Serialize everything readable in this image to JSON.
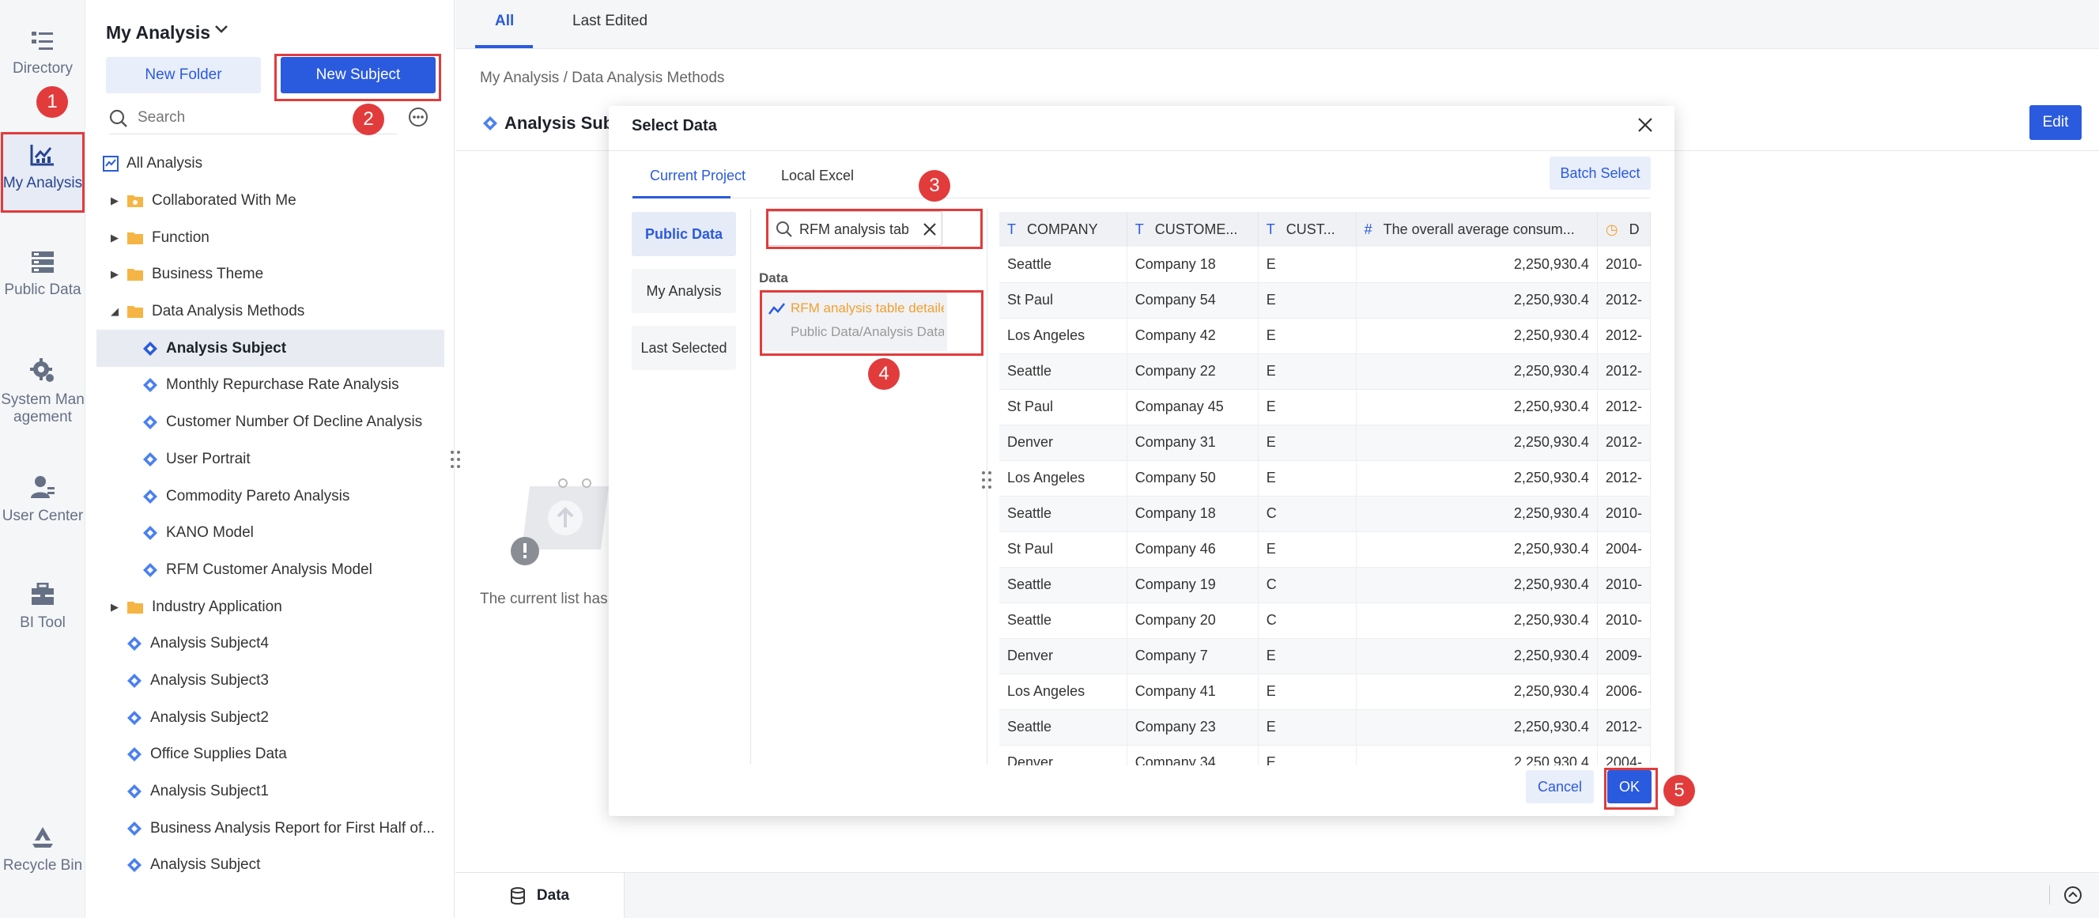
{
  "rail": {
    "items": [
      {
        "label": "Directory"
      },
      {
        "label": "My Analysis"
      },
      {
        "label": "Public Data"
      },
      {
        "label": "System Man agement"
      },
      {
        "label": "User Center"
      },
      {
        "label": "BI Tool"
      },
      {
        "label": "Recycle Bin"
      }
    ]
  },
  "directory": {
    "title": "My Analysis",
    "new_folder": "New Folder",
    "new_subject": "New Subject",
    "search_placeholder": "Search",
    "tree": [
      {
        "label": "All Analysis"
      },
      {
        "label": "Collaborated With Me"
      },
      {
        "label": "Function"
      },
      {
        "label": "Business Theme"
      },
      {
        "label": "Data Analysis Methods"
      },
      {
        "label": "Analysis Subject"
      },
      {
        "label": "Monthly Repurchase Rate Analysis"
      },
      {
        "label": "Customer Number Of Decline Analysis"
      },
      {
        "label": "User Portrait"
      },
      {
        "label": "Commodity Pareto Analysis"
      },
      {
        "label": "KANO Model"
      },
      {
        "label": "RFM Customer Analysis Model"
      },
      {
        "label": "Industry Application"
      },
      {
        "label": "Analysis Subject4"
      },
      {
        "label": "Analysis Subject3"
      },
      {
        "label": "Analysis Subject2"
      },
      {
        "label": "Office Supplies Data"
      },
      {
        "label": "Analysis Subject1"
      },
      {
        "label": "Business Analysis Report for First Half of..."
      },
      {
        "label": "Analysis Subject"
      }
    ]
  },
  "main": {
    "tabs": [
      {
        "label": "All"
      },
      {
        "label": "Last Edited"
      }
    ],
    "breadcrumb": "My Analysis  /  Data Analysis Methods",
    "title": "Analysis Subj",
    "edit": "Edit",
    "empty_text": "The current list has",
    "bottom_tab": "Data"
  },
  "dialog": {
    "title": "Select Data",
    "tabs": [
      {
        "label": "Current Project"
      },
      {
        "label": "Local Excel"
      }
    ],
    "batch_select": "Batch Select",
    "sources": [
      {
        "label": "Public Data"
      },
      {
        "label": "My Analysis"
      },
      {
        "label": "Last Selected"
      }
    ],
    "search_value": "RFM analysis table ...",
    "data_label": "Data",
    "dataset": {
      "name": "RFM analysis table detailed...",
      "path": "Public Data/Analysis Data/..."
    },
    "columns": [
      "COMPANY",
      "CUSTOME...",
      "CUST...",
      "The overall average consum...",
      "D"
    ],
    "column_types": [
      "T",
      "T",
      "T",
      "#",
      "date"
    ],
    "rows": [
      [
        "Seattle",
        "Company 18",
        "E",
        "2,250,930.4",
        "2010-"
      ],
      [
        "St Paul",
        "Company 54",
        "E",
        "2,250,930.4",
        "2012-"
      ],
      [
        "Los Angeles",
        "Company 42",
        "E",
        "2,250,930.4",
        "2012-"
      ],
      [
        "Seattle",
        "Company 22",
        "E",
        "2,250,930.4",
        "2012-"
      ],
      [
        "St Paul",
        "Companay 45",
        "E",
        "2,250,930.4",
        "2012-"
      ],
      [
        "Denver",
        "Company 31",
        "E",
        "2,250,930.4",
        "2012-"
      ],
      [
        "Los Angeles",
        "Company 50",
        "E",
        "2,250,930.4",
        "2012-"
      ],
      [
        "Seattle",
        "Company 18",
        "C",
        "2,250,930.4",
        "2010-"
      ],
      [
        "St Paul",
        "Company 46",
        "E",
        "2,250,930.4",
        "2004-"
      ],
      [
        "Seattle",
        "Company 19",
        "C",
        "2,250,930.4",
        "2010-"
      ],
      [
        "Seattle",
        "Company 20",
        "C",
        "2,250,930.4",
        "2010-"
      ],
      [
        "Denver",
        "Company 7",
        "E",
        "2,250,930.4",
        "2009-"
      ],
      [
        "Los Angeles",
        "Company 41",
        "E",
        "2,250,930.4",
        "2006-"
      ],
      [
        "Seattle",
        "Company 23",
        "E",
        "2,250,930.4",
        "2012-"
      ],
      [
        "Denver",
        "Company 34",
        "E",
        "2,250,930.4",
        "2004-"
      ]
    ],
    "cancel": "Cancel",
    "ok": "OK"
  },
  "markers": [
    "1",
    "2",
    "3",
    "4",
    "5"
  ],
  "colors": {
    "accent": "#2a5ade",
    "marker": "#e23b3b",
    "folder": "#f5b544",
    "dataset": "#f0a030"
  }
}
